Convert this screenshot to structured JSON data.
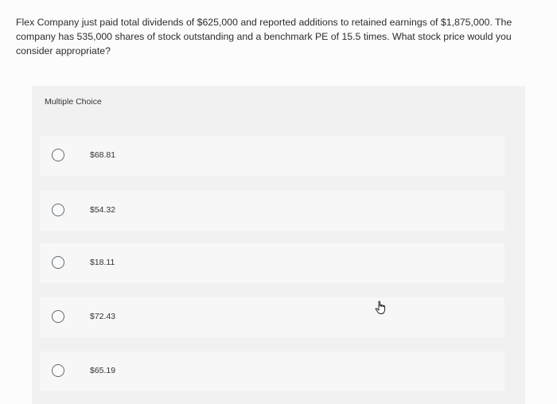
{
  "question": {
    "text": "Flex Company just paid total dividends of $625,000 and reported additions to retained earnings of $1,875,000. The company has 535,000 shares of stock outstanding and a benchmark PE of 15.5 times. What stock price would you consider appropriate?"
  },
  "multiple_choice": {
    "header": "Multiple Choice",
    "options": [
      {
        "label": "$68.81"
      },
      {
        "label": "$54.32"
      },
      {
        "label": "$18.11"
      },
      {
        "label": "$72.43"
      },
      {
        "label": "$65.19"
      }
    ]
  },
  "icons": {
    "cursor": "hand-pointer-icon"
  }
}
